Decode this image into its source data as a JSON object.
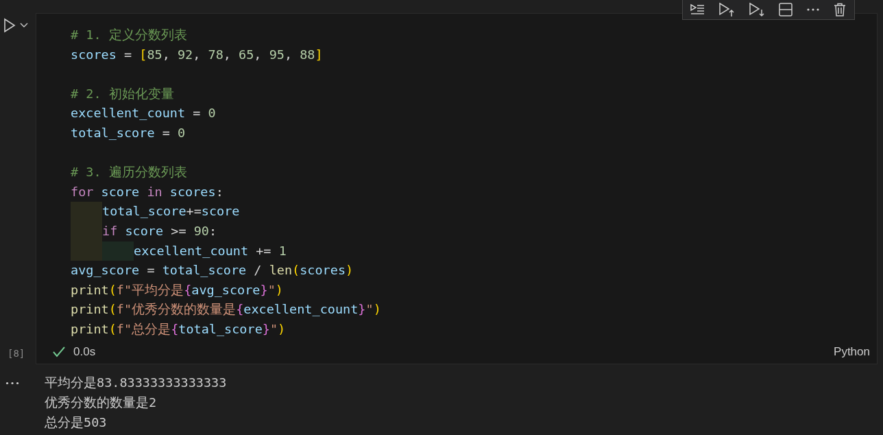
{
  "cell": {
    "execution_count": "[8]",
    "code": [
      {
        "tokens": [
          {
            "kind": "comment",
            "text": "# 1. 定义分数列表"
          }
        ]
      },
      {
        "tokens": [
          {
            "kind": "var",
            "text": "scores"
          },
          {
            "kind": "op",
            "text": " = "
          },
          {
            "kind": "bracket",
            "text": "["
          },
          {
            "kind": "num",
            "text": "85"
          },
          {
            "kind": "op",
            "text": ", "
          },
          {
            "kind": "num",
            "text": "92"
          },
          {
            "kind": "op",
            "text": ", "
          },
          {
            "kind": "num",
            "text": "78"
          },
          {
            "kind": "op",
            "text": ", "
          },
          {
            "kind": "num",
            "text": "65"
          },
          {
            "kind": "op",
            "text": ", "
          },
          {
            "kind": "num",
            "text": "95"
          },
          {
            "kind": "op",
            "text": ", "
          },
          {
            "kind": "num",
            "text": "88"
          },
          {
            "kind": "bracket",
            "text": "]"
          }
        ]
      },
      {
        "kind": "blank"
      },
      {
        "tokens": [
          {
            "kind": "comment",
            "text": "# 2. 初始化变量"
          }
        ]
      },
      {
        "tokens": [
          {
            "kind": "var",
            "text": "excellent_count"
          },
          {
            "kind": "op",
            "text": " = "
          },
          {
            "kind": "num",
            "text": "0"
          }
        ]
      },
      {
        "tokens": [
          {
            "kind": "var",
            "text": "total_score"
          },
          {
            "kind": "op",
            "text": " = "
          },
          {
            "kind": "num",
            "text": "0"
          }
        ]
      },
      {
        "kind": "blank"
      },
      {
        "tokens": [
          {
            "kind": "comment",
            "text": "# 3. 遍历分数列表"
          }
        ]
      },
      {
        "tokens": [
          {
            "kind": "keyword",
            "text": "for "
          },
          {
            "kind": "var",
            "text": "score "
          },
          {
            "kind": "keyword",
            "text": "in "
          },
          {
            "kind": "var",
            "text": "scores"
          },
          {
            "kind": "op",
            "text": ":"
          }
        ],
        "children": [
          {
            "tokens": [
              {
                "kind": "var",
                "text": "total_score"
              },
              {
                "kind": "op",
                "text": "+="
              },
              {
                "kind": "var",
                "text": "score"
              }
            ]
          },
          {
            "tokens": [
              {
                "kind": "keyword",
                "text": "if "
              },
              {
                "kind": "var",
                "text": "score"
              },
              {
                "kind": "op",
                "text": " >= "
              },
              {
                "kind": "num",
                "text": "90"
              },
              {
                "kind": "op",
                "text": ":"
              }
            ],
            "children": [
              {
                "tokens": [
                  {
                    "kind": "var",
                    "text": "excellent_count"
                  },
                  {
                    "kind": "op",
                    "text": " += "
                  },
                  {
                    "kind": "num",
                    "text": "1"
                  }
                ]
              }
            ]
          }
        ]
      },
      {
        "tokens": [
          {
            "kind": "var",
            "text": "avg_score"
          },
          {
            "kind": "op",
            "text": " = "
          },
          {
            "kind": "var",
            "text": "total_score"
          },
          {
            "kind": "op",
            "text": " / "
          },
          {
            "kind": "func",
            "text": "len"
          },
          {
            "kind": "bracket",
            "text": "("
          },
          {
            "kind": "var",
            "text": "scores"
          },
          {
            "kind": "bracket",
            "text": ")"
          }
        ]
      },
      {
        "tokens": [
          {
            "kind": "func",
            "text": "print"
          },
          {
            "kind": "bracket",
            "text": "("
          },
          {
            "kind": "string",
            "text": "f\"平均分是"
          },
          {
            "kind": "brace",
            "text": "{"
          },
          {
            "kind": "var",
            "text": "avg_score"
          },
          {
            "kind": "brace",
            "text": "}"
          },
          {
            "kind": "string",
            "text": "\""
          },
          {
            "kind": "bracket",
            "text": ")"
          }
        ]
      },
      {
        "tokens": [
          {
            "kind": "func",
            "text": "print"
          },
          {
            "kind": "bracket",
            "text": "("
          },
          {
            "kind": "string",
            "text": "f\"优秀分数的数量是"
          },
          {
            "kind": "brace",
            "text": "{"
          },
          {
            "kind": "var",
            "text": "excellent_count"
          },
          {
            "kind": "brace",
            "text": "}"
          },
          {
            "kind": "string",
            "text": "\""
          },
          {
            "kind": "bracket",
            "text": ")"
          }
        ]
      },
      {
        "tokens": [
          {
            "kind": "func",
            "text": "print"
          },
          {
            "kind": "bracket",
            "text": "("
          },
          {
            "kind": "string",
            "text": "f\"总分是"
          },
          {
            "kind": "brace",
            "text": "{"
          },
          {
            "kind": "var",
            "text": "total_score"
          },
          {
            "kind": "brace",
            "text": "}"
          },
          {
            "kind": "string",
            "text": "\""
          },
          {
            "kind": "bracket",
            "text": ")"
          }
        ]
      }
    ],
    "status": {
      "succeeded": true,
      "duration": "0.0s"
    },
    "language": "Python",
    "outputs": [
      "平均分是83.83333333333333",
      "优秀分数的数量是2",
      "总分是503"
    ]
  }
}
